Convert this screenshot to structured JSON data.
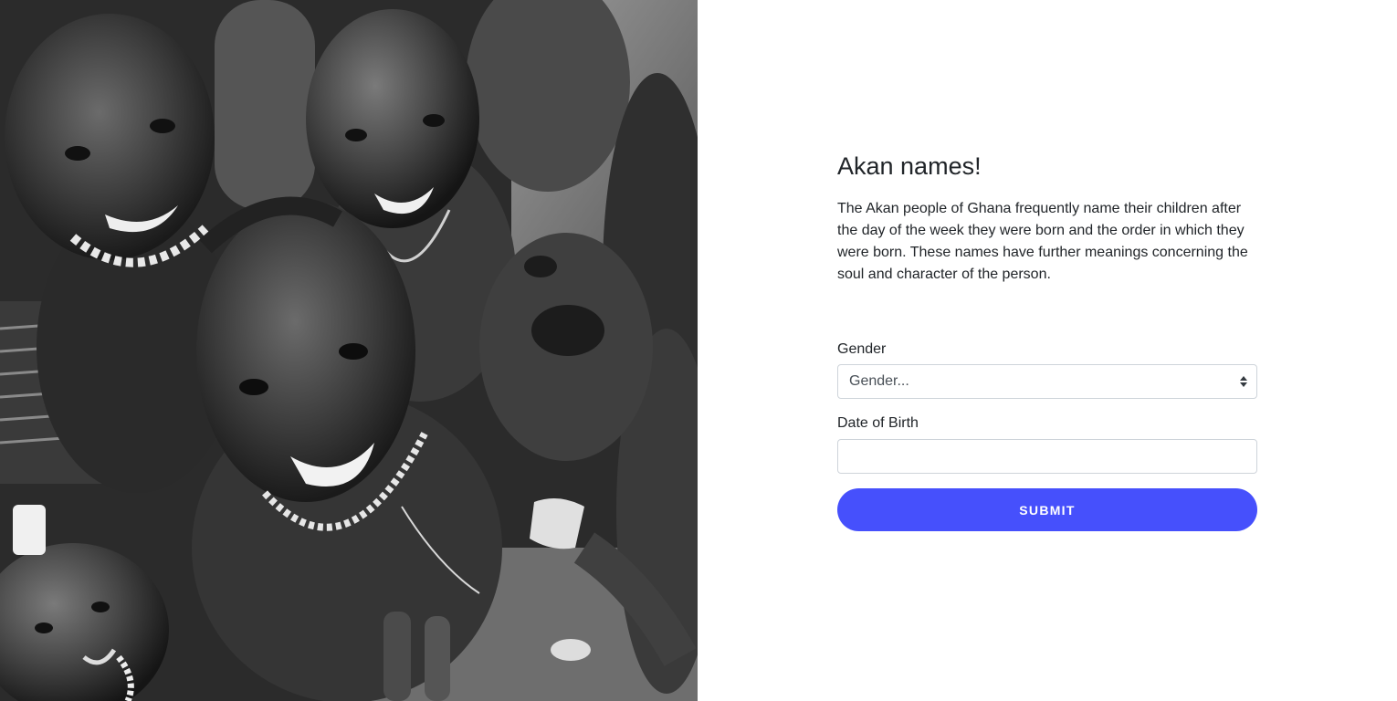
{
  "hero": {
    "icon": "children-photo"
  },
  "header": {
    "title": "Akan names!"
  },
  "intro": {
    "text": "The Akan people of Ghana frequently name their children after the day of the week they were born and the order in which they were born. These names have further meanings concerning the soul and character of the person."
  },
  "form": {
    "gender_label": "Gender",
    "gender_selected": "Gender...",
    "dob_label": "Date of Birth",
    "dob_value": "",
    "submit_label": "SUBMIT"
  },
  "colors": {
    "accent": "#4650fc",
    "border": "#ced4da",
    "text": "#212529"
  }
}
